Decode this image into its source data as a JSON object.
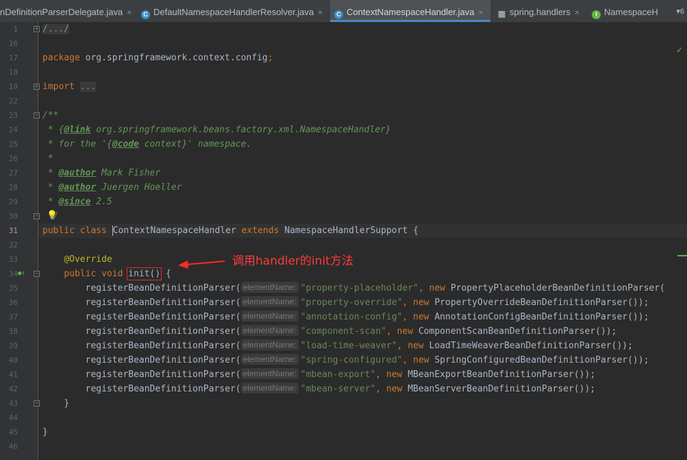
{
  "tabs": [
    {
      "label": "nDefinitionParserDelegate.java",
      "icon": "close-icon"
    },
    {
      "label": "DefaultNamespaceHandlerResolver.java",
      "icon": "class-icon"
    },
    {
      "label": "ContextNamespaceHandler.java",
      "icon": "class-icon",
      "active": true
    },
    {
      "label": "spring.handlers",
      "icon": "properties-file-icon"
    },
    {
      "label": "NamespaceH",
      "icon": "interface-icon"
    }
  ],
  "tab_icon_letters": {
    "class": "C",
    "interface": "I"
  },
  "tab_close_glyph": "×",
  "tab_overflow": "▾6",
  "line_numbers": [
    "1",
    "16",
    "17",
    "18",
    "19",
    "22",
    "23",
    "24",
    "25",
    "26",
    "27",
    "28",
    "29",
    "30",
    "31",
    "32",
    "33",
    "34",
    "35",
    "36",
    "37",
    "38",
    "39",
    "40",
    "41",
    "42",
    "43",
    "44",
    "45",
    "46"
  ],
  "current_line": "31",
  "code": {
    "l1": "/.../",
    "pkg_kw": "package",
    "pkg_name": " org.springframework.context.config",
    "semicolon": ";",
    "import_kw": "import",
    "import_fold": "...",
    "doc_open": "/**",
    "doc_link_prefix": " * {",
    "doc_link_tag": "@link",
    "doc_link_text": " org.springframework.beans.factory.xml.NamespaceHandler}",
    "doc_for_prefix": " * for the '{",
    "doc_code_tag": "@code",
    "doc_for_suffix": " context}' namespace.",
    "doc_star": " *",
    "doc_author_prefix": " * ",
    "doc_author_tag": "@author",
    "doc_author1": " Mark Fisher",
    "doc_author2": " Juergen Hoeller",
    "doc_since_tag": "@since",
    "doc_since_val": " 2.5",
    "doc_close": " */",
    "class_public": "public",
    "class_kw": "class",
    "class_name": "ContextNamespaceHandler",
    "extends_kw": "extends",
    "super_name": "NamespaceHandlerSupport",
    "open_brace": "{",
    "close_brace": "}",
    "override": "@Override",
    "method_public": "public",
    "method_void": "void",
    "method_name": "init()",
    "register_call": "registerBeanDefinitionParser(",
    "param_hint": "elementName:",
    "new_kw": "new",
    "comma": ",",
    "call_close": "());",
    "registrations": [
      {
        "key": "\"property-placeholder\"",
        "parser": "PropertyPlaceholderBeanDefinitionParser(",
        "close": ""
      },
      {
        "key": "\"property-override\"",
        "parser": "PropertyOverrideBeanDefinitionParser",
        "close": "());"
      },
      {
        "key": "\"annotation-config\"",
        "parser": "AnnotationConfigBeanDefinitionParser",
        "close": "());"
      },
      {
        "key": "\"component-scan\"",
        "parser": "ComponentScanBeanDefinitionParser",
        "close": "());"
      },
      {
        "key": "\"load-time-weaver\"",
        "parser": "LoadTimeWeaverBeanDefinitionParser",
        "close": "());"
      },
      {
        "key": "\"spring-configured\"",
        "parser": "SpringConfiguredBeanDefinitionParser",
        "close": "());"
      },
      {
        "key": "\"mbean-export\"",
        "parser": "MBeanExportBeanDefinitionParser",
        "close": "());"
      },
      {
        "key": "\"mbean-server\"",
        "parser": "MBeanServerBeanDefinitionParser",
        "close": "());"
      }
    ]
  },
  "callout": "调用handler的init方法",
  "inspection_icon": "✓",
  "bulb_icon": "💡"
}
